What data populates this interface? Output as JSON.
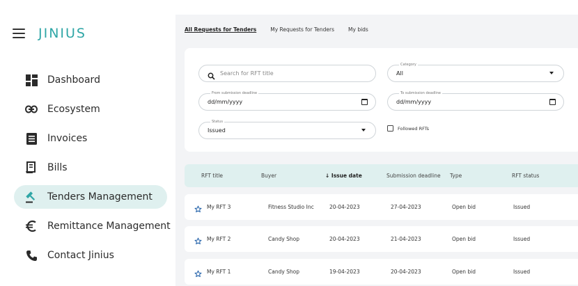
{
  "app": {
    "logo": "JINIUS"
  },
  "sidebar": {
    "items": [
      {
        "label": "Dashboard",
        "icon": "dashboard-icon"
      },
      {
        "label": "Ecosystem",
        "icon": "link-icon"
      },
      {
        "label": "Invoices",
        "icon": "invoice-icon"
      },
      {
        "label": "Bills",
        "icon": "receipt-icon"
      },
      {
        "label": "Tenders Management",
        "icon": "gavel-icon",
        "active": true
      },
      {
        "label": "Remittance Management",
        "icon": "euro-icon"
      },
      {
        "label": "Contact Jinius",
        "icon": "phone-icon"
      }
    ]
  },
  "tabs": [
    {
      "label": "All Requests for Tenders",
      "active": true
    },
    {
      "label": "My Requests for Tenders"
    },
    {
      "label": "My bids"
    }
  ],
  "filters": {
    "search_placeholder": "Search for RFT title",
    "category_label": "Category",
    "category_value": "All",
    "from_label": "From submission deadline",
    "from_value": "dd/mm/yyyy",
    "to_label": "To submission deadline",
    "to_value": "dd/mm/yyyy",
    "status_label": "Status",
    "status_value": "Issued",
    "followed_label": "Followed RFTs"
  },
  "table": {
    "headers": [
      "RFT title",
      "Buyer",
      "Issue date",
      "Submission deadline",
      "Type",
      "RFT status"
    ],
    "sort_arrow": "↓",
    "rows": [
      [
        "My RFT 3",
        "Fitness Studio Inc",
        "20-04-2023",
        "27-04-2023",
        "Open bid",
        "Issued"
      ],
      [
        "My RFT 2",
        "Candy Shop",
        "20-04-2023",
        "21-04-2023",
        "Open bid",
        "Issued"
      ],
      [
        "My RFT 1",
        "Candy Shop",
        "19-04-2023",
        "20-04-2023",
        "Open bid",
        "Issued"
      ]
    ]
  },
  "colors": {
    "accent": "#2fa6a6",
    "active_bg": "#dff0ef",
    "star": "#1f5fa8"
  }
}
